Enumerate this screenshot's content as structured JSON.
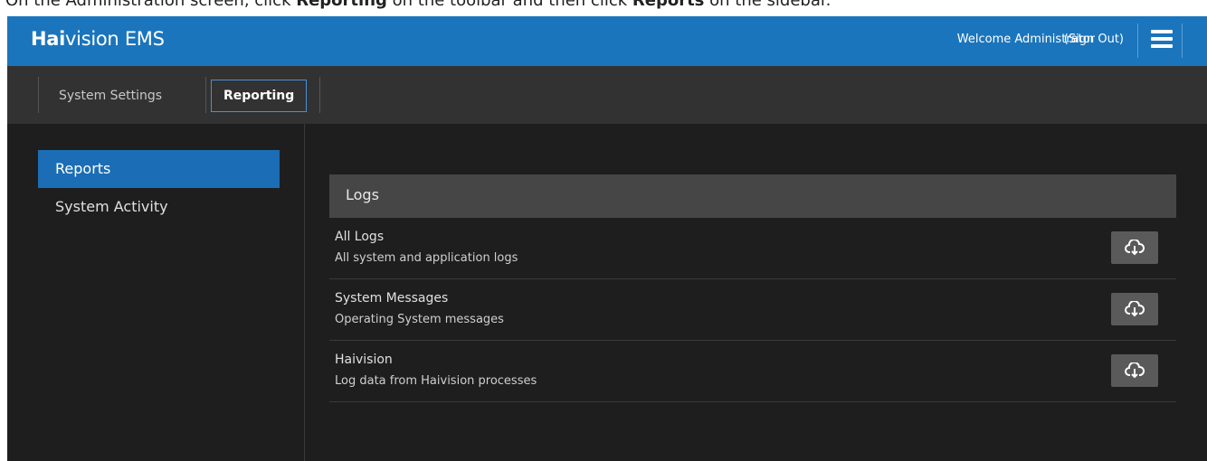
{
  "caption": {
    "prefix": "On the Administration screen, click ",
    "bold1": "Reporting",
    "middle": " on the toolbar and then click ",
    "bold2": "Reports",
    "suffix": " on the sidebar."
  },
  "header": {
    "logo_strong": "Hai",
    "logo_rest": "vision EMS",
    "welcome": "Welcome Administrator",
    "sign_out": "(Sign Out)",
    "menu_icon": "hamburger-menu-icon"
  },
  "toolbar": {
    "tabs": [
      {
        "label": "System Settings",
        "active": false
      },
      {
        "label": "Reporting",
        "active": true
      }
    ]
  },
  "sidebar": {
    "items": [
      {
        "label": "Reports",
        "active": true
      },
      {
        "label": "System Activity",
        "active": false
      }
    ]
  },
  "logs": {
    "title": "Logs",
    "download_icon": "cloud-download-icon",
    "rows": [
      {
        "title": "All Logs",
        "description": "All system and application logs"
      },
      {
        "title": "System Messages",
        "description": "Operating System messages"
      },
      {
        "title": "Haivision",
        "description": "Log data from Haivision processes"
      }
    ]
  },
  "colors": {
    "header_bg": "#1b75bc",
    "toolbar_bg": "#323232",
    "body_bg": "#1e1e1e",
    "active_item": "#1b6db5",
    "panel_head": "#464646",
    "button_bg": "#5a5a5a"
  }
}
